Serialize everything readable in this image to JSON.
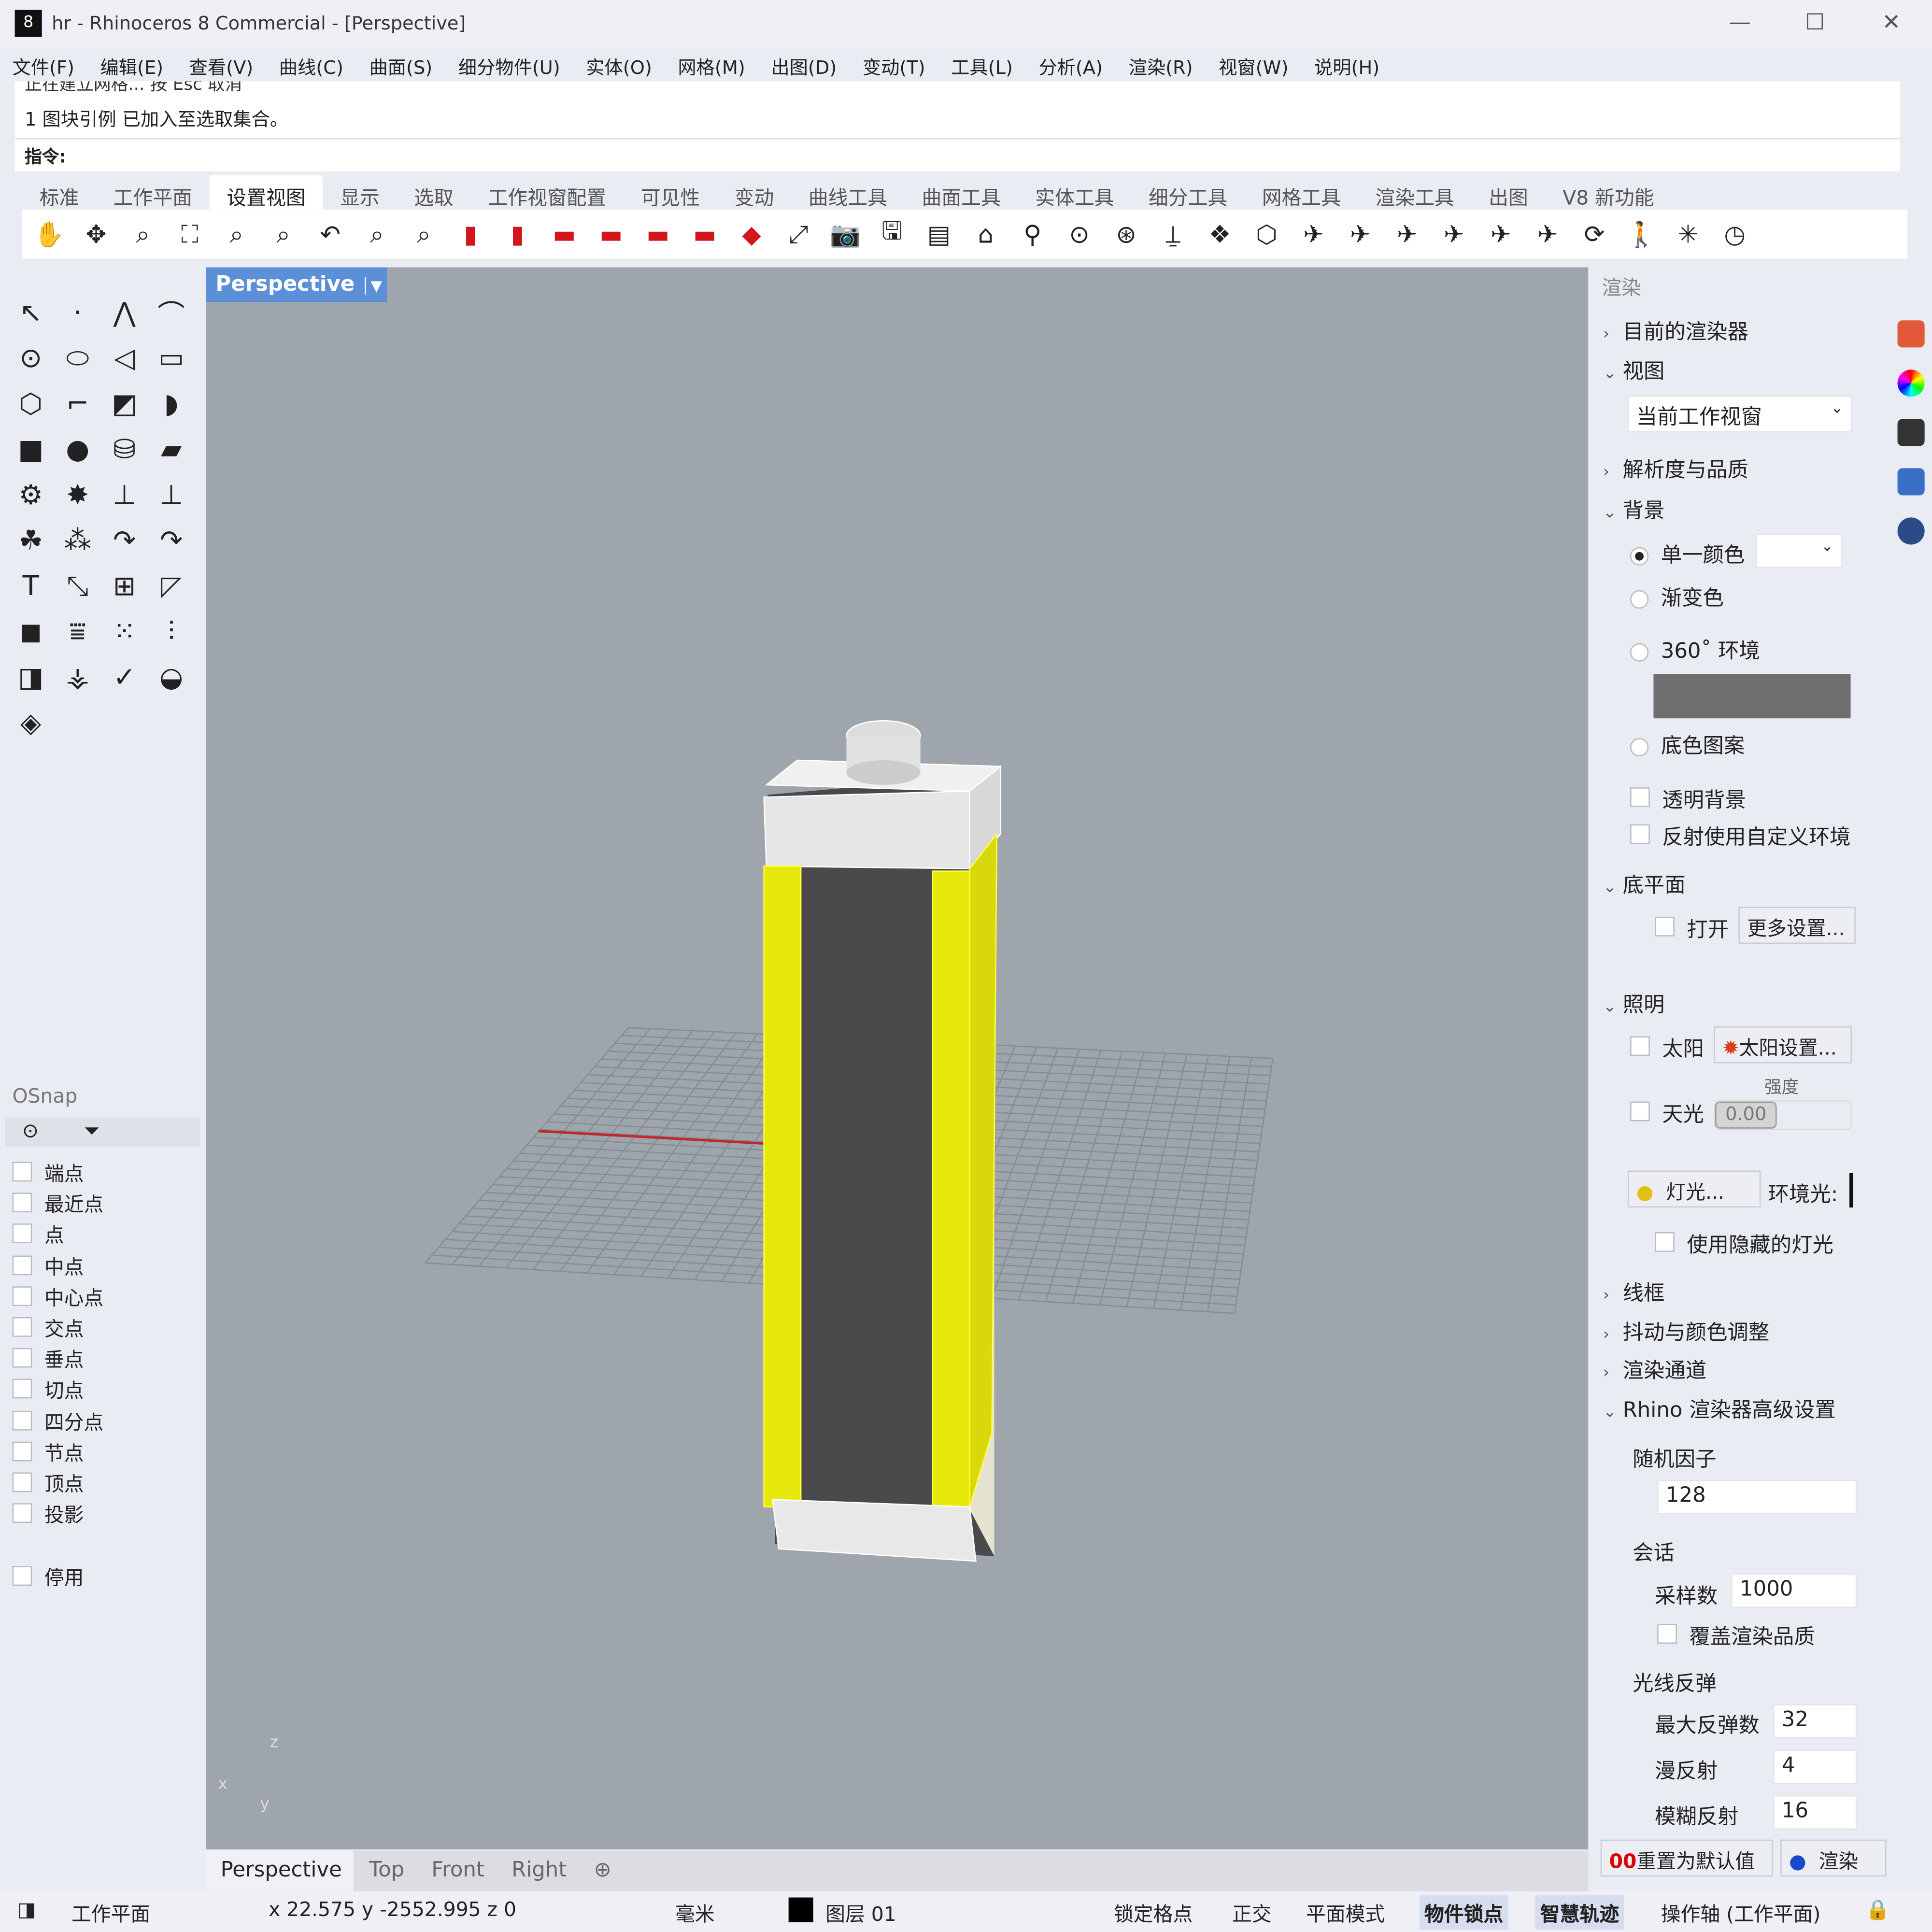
{
  "window": {
    "title": "hr - Rhinoceros 8 Commercial - [Perspective]",
    "minimize": "—",
    "maximize": "☐",
    "close": "✕"
  },
  "menu": [
    "文件(F)",
    "编辑(E)",
    "查看(V)",
    "曲线(C)",
    "曲面(S)",
    "细分物件(U)",
    "实体(O)",
    "网格(M)",
    "出图(D)",
    "变动(T)",
    "工具(L)",
    "分析(A)",
    "渲染(R)",
    "视窗(W)",
    "说明(H)"
  ],
  "command": {
    "history_1": "正在建立网格... 按 Esc 取消",
    "history_2": "1 图块引例 已加入至选取集合。",
    "prompt": "指令:"
  },
  "toolbar_tabs": {
    "active": 2,
    "items": [
      "标准",
      "工作平面",
      "设置视图",
      "显示",
      "选取",
      "工作视窗配置",
      "可见性",
      "变动",
      "曲线工具",
      "曲面工具",
      "实体工具",
      "细分工具",
      "网格工具",
      "渲染工具",
      "出图",
      "V8 新功能"
    ]
  },
  "toolbar_icons": [
    {
      "n": "pan-icon",
      "g": "✋"
    },
    {
      "n": "rotate-view-icon",
      "g": "✥"
    },
    {
      "n": "zoom-icon",
      "g": "⌕"
    },
    {
      "n": "zoom-extents-icon",
      "g": "⛶"
    },
    {
      "n": "zoom-window-icon",
      "g": "⌕"
    },
    {
      "n": "zoom-selected-icon",
      "g": "⌕"
    },
    {
      "n": "undo-view-icon",
      "g": "↶"
    },
    {
      "n": "zoom-out-icon",
      "g": "⌕"
    },
    {
      "n": "zoom-1to1-icon",
      "g": "⌕"
    },
    {
      "n": "view-front-icon",
      "g": "▮",
      "c": "red"
    },
    {
      "n": "view-back-icon",
      "g": "▮",
      "c": "red"
    },
    {
      "n": "view-left-icon",
      "g": "▬",
      "c": "red"
    },
    {
      "n": "view-right-icon",
      "g": "▬",
      "c": "red"
    },
    {
      "n": "view-top-icon",
      "g": "▬",
      "c": "red"
    },
    {
      "n": "view-bottom-icon",
      "g": "▬",
      "c": "red"
    },
    {
      "n": "view-perspective-icon",
      "g": "◆",
      "c": "red"
    },
    {
      "n": "camera-move-icon",
      "g": "⤢"
    },
    {
      "n": "camera-icon",
      "g": "📷"
    },
    {
      "n": "save-view-icon",
      "g": "🖫"
    },
    {
      "n": "named-views-icon",
      "g": "▤"
    },
    {
      "n": "place-camera-icon",
      "g": "⌂"
    },
    {
      "n": "target-icon",
      "g": "⚲"
    },
    {
      "n": "cplane-origin-icon",
      "g": "⊙"
    },
    {
      "n": "cplane-object-icon",
      "g": "⊛"
    },
    {
      "n": "cplane-elevation-icon",
      "g": "⍊"
    },
    {
      "n": "cplane-3point-icon",
      "g": "❖"
    },
    {
      "n": "cplane-view-icon",
      "g": "⬡"
    },
    {
      "n": "set-view-1-icon",
      "g": "✈"
    },
    {
      "n": "set-view-2-icon",
      "g": "✈"
    },
    {
      "n": "set-view-3-icon",
      "g": "✈"
    },
    {
      "n": "set-view-4-icon",
      "g": "✈"
    },
    {
      "n": "set-view-5-icon",
      "g": "✈"
    },
    {
      "n": "set-view-6-icon",
      "g": "✈"
    },
    {
      "n": "turntable-360-icon",
      "g": "⟳"
    },
    {
      "n": "walkabout-icon",
      "g": "🚶"
    },
    {
      "n": "snapshot-icon",
      "g": "✳"
    },
    {
      "n": "clock-icon",
      "g": "◷"
    }
  ],
  "left_tools": [
    {
      "n": "select-icon",
      "g": "↖"
    },
    {
      "n": "point-icon",
      "g": "·"
    },
    {
      "n": "polyline-icon",
      "g": "⋀"
    },
    {
      "n": "curve-icon",
      "g": "⌒"
    },
    {
      "n": "circle-icon",
      "g": "⊙"
    },
    {
      "n": "ellipse-icon",
      "g": "⬭"
    },
    {
      "n": "arc-icon",
      "g": "◁"
    },
    {
      "n": "rectangle-icon",
      "g": "▭"
    },
    {
      "n": "polygon-icon",
      "g": "⬡"
    },
    {
      "n": "fillet-icon",
      "g": "⌐"
    },
    {
      "n": "surface-icon",
      "g": "◩"
    },
    {
      "n": "revolve-icon",
      "g": "◗"
    },
    {
      "n": "box-icon",
      "g": "■"
    },
    {
      "n": "sphere-icon",
      "g": "●"
    },
    {
      "n": "cylinder-icon",
      "g": "⛁"
    },
    {
      "n": "mesh-plane-icon",
      "g": "▰"
    },
    {
      "n": "gear-tool-icon",
      "g": "⚙"
    },
    {
      "n": "explode-icon",
      "g": "✸"
    },
    {
      "n": "trim-icon",
      "g": "⊥"
    },
    {
      "n": "split-icon",
      "g": "⊥"
    },
    {
      "n": "boolean-icon",
      "g": "☘"
    },
    {
      "n": "group-icon",
      "g": "⁂"
    },
    {
      "n": "rotate-icon",
      "g": "↷"
    },
    {
      "n": "move-curve-icon",
      "g": "↷"
    },
    {
      "n": "text-icon",
      "g": "T"
    },
    {
      "n": "scale-icon",
      "g": "⤡"
    },
    {
      "n": "block-icon",
      "g": "⊞"
    },
    {
      "n": "dimension-icon",
      "g": "◸"
    },
    {
      "n": "solid-icon",
      "g": "◼"
    },
    {
      "n": "contour-icon",
      "g": "⩸"
    },
    {
      "n": "array-icon",
      "g": "⁙"
    },
    {
      "n": "gumball-icon",
      "g": "⫶"
    },
    {
      "n": "extrude-icon",
      "g": "◨"
    },
    {
      "n": "analyze-icon",
      "g": "⚶"
    },
    {
      "n": "check-icon",
      "g": "✓"
    },
    {
      "n": "shade-icon",
      "g": "◒"
    },
    {
      "n": "render-tool-icon",
      "g": "◈"
    }
  ],
  "osnap": {
    "title": "OSnap",
    "items": [
      "端点",
      "最近点",
      "点",
      "中点",
      "中心点",
      "交点",
      "垂点",
      "切点",
      "四分点",
      "节点",
      "顶点",
      "投影"
    ],
    "disable": "停用"
  },
  "viewport": {
    "label": "Perspective",
    "tabs": [
      "Perspective",
      "Top",
      "Front",
      "Right"
    ],
    "active_tab": 0,
    "axes": {
      "x": "x",
      "y": "y",
      "z": "z"
    }
  },
  "render_panel": {
    "title": "渲染",
    "current_renderer": "目前的渲染器",
    "view_section": "视图",
    "view_value": "当前工作视窗",
    "resolution": "解析度与品质",
    "background": "背景",
    "bg_solid": "单一颜色",
    "bg_gradient": "渐变色",
    "bg_360": "360˚ 环境",
    "bg_wallpaper": "底色图案",
    "transparent_bg": "透明背景",
    "custom_reflection": "反射使用自定义环境",
    "ground_plane": "底平面",
    "gp_on": "打开",
    "gp_more": "更多设置...",
    "lighting": "照明",
    "sun": "太阳",
    "sun_settings": "太阳设置...",
    "intensity": "强度",
    "skylight": "天光",
    "skylight_value": "0.00",
    "lights_btn": "灯光...",
    "ambient": "环境光:",
    "hidden_lights": "使用隐藏的灯光",
    "wireframe": "线框",
    "dither": "抖动与颜色调整",
    "channels": "渲染通道",
    "advanced": "Rhino 渲染器高级设置",
    "seed_label": "随机因子",
    "seed": "128",
    "session": "会话",
    "samples_label": "采样数",
    "samples": "1000",
    "override_quality": "覆盖渲染品质",
    "bounces": "光线反弹",
    "max_bounces_label": "最大反弹数",
    "max_bounces": "32",
    "diffuse_label": "漫反射",
    "diffuse": "4",
    "glossy_label": "模糊反射",
    "glossy": "16",
    "reset": "重置为默认值",
    "render": "渲染"
  },
  "status": {
    "cplane": "工作平面",
    "coords": "x 22.575  y -2552.995  z 0",
    "units": "毫米",
    "layer": "图层 01",
    "grid_snap": "锁定格点",
    "ortho": "正交",
    "planar": "平面模式",
    "osnap": "物件锁点",
    "smarttrack": "智慧轨迹",
    "gumball": "操作轴 (工作平面)"
  },
  "colors": {
    "viewport_bg": "#9ea5ad",
    "selection": "#ffff00",
    "accent": "#5b8fd8",
    "panel_bg": "#e9ecf2"
  }
}
